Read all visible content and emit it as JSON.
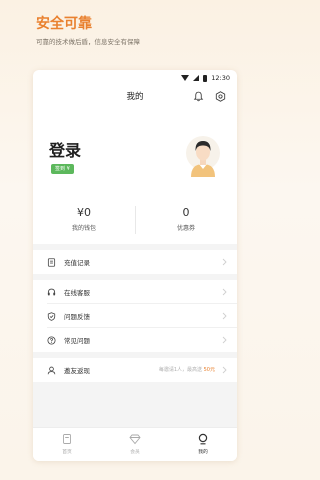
{
  "promo": {
    "title": "安全可靠",
    "subtitle": "可靠的技术做后盾，信息安全有保障"
  },
  "status_bar": {
    "time": "12:30"
  },
  "header": {
    "title": "我的",
    "icons": [
      "bell-icon",
      "gear-icon"
    ]
  },
  "profile": {
    "login_label": "登录",
    "badge": "签到 ¥"
  },
  "stats": [
    {
      "value": "¥0",
      "label": "我的钱包"
    },
    {
      "value": "0",
      "label": "优惠券"
    }
  ],
  "menu": {
    "recharge": {
      "label": "充值记录",
      "icon": "receipt-icon"
    },
    "service": {
      "label": "在线客服",
      "icon": "headset-icon"
    },
    "feedback": {
      "label": "问题反馈",
      "icon": "shield-icon"
    },
    "faq": {
      "label": "常见问题",
      "icon": "question-icon"
    },
    "invite": {
      "label": "邀友返现",
      "note_prefix": "每邀请1人，最高送",
      "note_amount": "50元",
      "icon": "user-icon"
    }
  },
  "tabs": [
    {
      "label": "首页",
      "icon": "home-icon",
      "active": false
    },
    {
      "label": "会员",
      "icon": "diamond-icon",
      "active": false
    },
    {
      "label": "我的",
      "icon": "profile-icon",
      "active": true
    }
  ],
  "colors": {
    "accent": "#e9812f",
    "badge": "#5cb85c",
    "background": "#fbf1e3"
  }
}
